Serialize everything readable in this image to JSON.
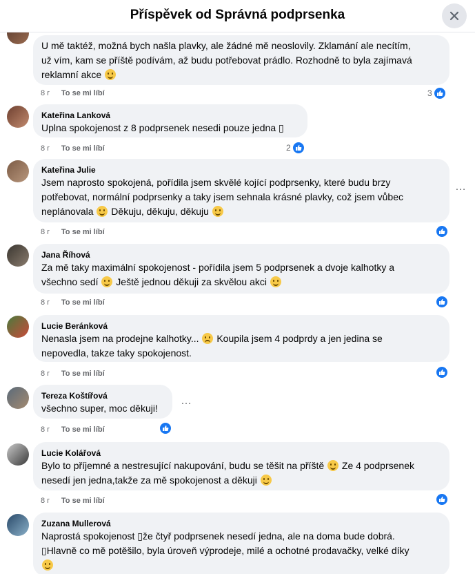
{
  "header": {
    "title": "Příspěvek od Správná podprsenka"
  },
  "labels": {
    "like": "To se mi líbí",
    "more": "…"
  },
  "comments": [
    {
      "author": "",
      "lines": [
        "U mě taktéž, možná bych našla plavky, ale žádné mě neoslovily. Zklamání ale necítím,",
        "už vím, kam se příště podívám, až budu potřebovat prádlo. Rozhodně to byla zajímavá",
        "reklamní akce"
      ],
      "time": "8 r",
      "likes": "3"
    },
    {
      "author": "Kateřina Lanková",
      "lines": [
        "Uplna spokojenost z 8 podprsenek nesedi pouze jedna ▯"
      ],
      "time": "8 r",
      "likes": "2"
    },
    {
      "author": "Kateřina Julie",
      "lines": [
        "Jsem naprosto spokojená, pořídila jsem skvělé kojící podprsenky, které budu brzy",
        "potřebovat, normální podprsenky a taky jsem sehnala krásné plavky, což jsem vůbec",
        "neplánovala",
        "Děkuju, děkuju, děkuju"
      ],
      "time": "8 r",
      "likes": ""
    },
    {
      "author": "Jana Říhová",
      "lines": [
        "Za mě taky maximální spokojenost - pořídila jsem 5 podprsenek a dvoje kalhotky a",
        "všechno sedí",
        "Ještě jednou děkuji za skvělou akci"
      ],
      "time": "8 r",
      "likes": ""
    },
    {
      "author": "Lucie Beránková",
      "lines": [
        "Nenasla jsem na prodejne kalhotky...",
        "Koupila jsem 4 podprdy a jen jedina se",
        "nepovedla, takze taky spokojenost."
      ],
      "time": "8 r",
      "likes": ""
    },
    {
      "author": "Tereza Koštířová",
      "lines": [
        "všechno super, moc děkuji!"
      ],
      "time": "8 r",
      "likes": ""
    },
    {
      "author": "Lucie Kolářová",
      "lines": [
        "Bylo to příjemné a nestresující nakupování, budu se těšit na příště",
        "Ze 4 podprsenek",
        "nesedí jen jedna,takže za mě spokojenost a děkuji"
      ],
      "time": "8 r",
      "likes": ""
    },
    {
      "author": "Zuzana Mullerová",
      "lines": [
        "Naprostá spokojenost ▯že čtyř podprsenek nesedí jedna, ale na doma bude dobrá.",
        "▯Hlavně co mě potěšilo, byla úroveň výprodeje, milé a ochotné prodavačky, velké díky"
      ],
      "time": "",
      "likes": ""
    }
  ]
}
